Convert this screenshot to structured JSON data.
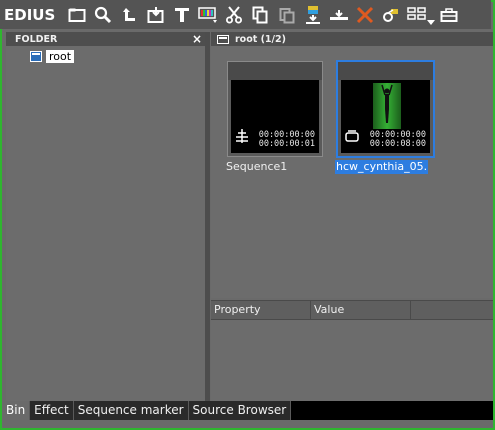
{
  "app": {
    "brand": "EDIUS"
  },
  "toolbar": {
    "icons": [
      "new-folder-icon",
      "search-icon",
      "up-folder-icon",
      "add-clip-icon",
      "title-icon",
      "color-bars-icon",
      "cut-icon",
      "copy-icon",
      "paste-icon",
      "add-to-timeline-icon",
      "insert-icon",
      "delete-icon",
      "properties-icon",
      "view-icon",
      "bin-settings-icon"
    ]
  },
  "folder_panel": {
    "title": "FOLDER",
    "close": "×",
    "tree": [
      {
        "label": "root"
      }
    ]
  },
  "bin": {
    "title": "root (1/2)",
    "clips": [
      {
        "name": "Sequence1",
        "tc_in": "00:00:00:00",
        "tc_out": "00:00:00:01",
        "type": "sequence"
      },
      {
        "name": "hcw_cynthia_05.",
        "tc_in": "00:00:00:00",
        "tc_out": "00:00:08:00",
        "type": "video",
        "selected": true
      }
    ]
  },
  "properties": {
    "columns": [
      "Property",
      "Value"
    ]
  },
  "tabs": [
    "Bin",
    "Effect",
    "Sequence marker",
    "Source Browser"
  ],
  "colors": {
    "frame": "#2fb62f",
    "selection": "#2d7de0"
  }
}
